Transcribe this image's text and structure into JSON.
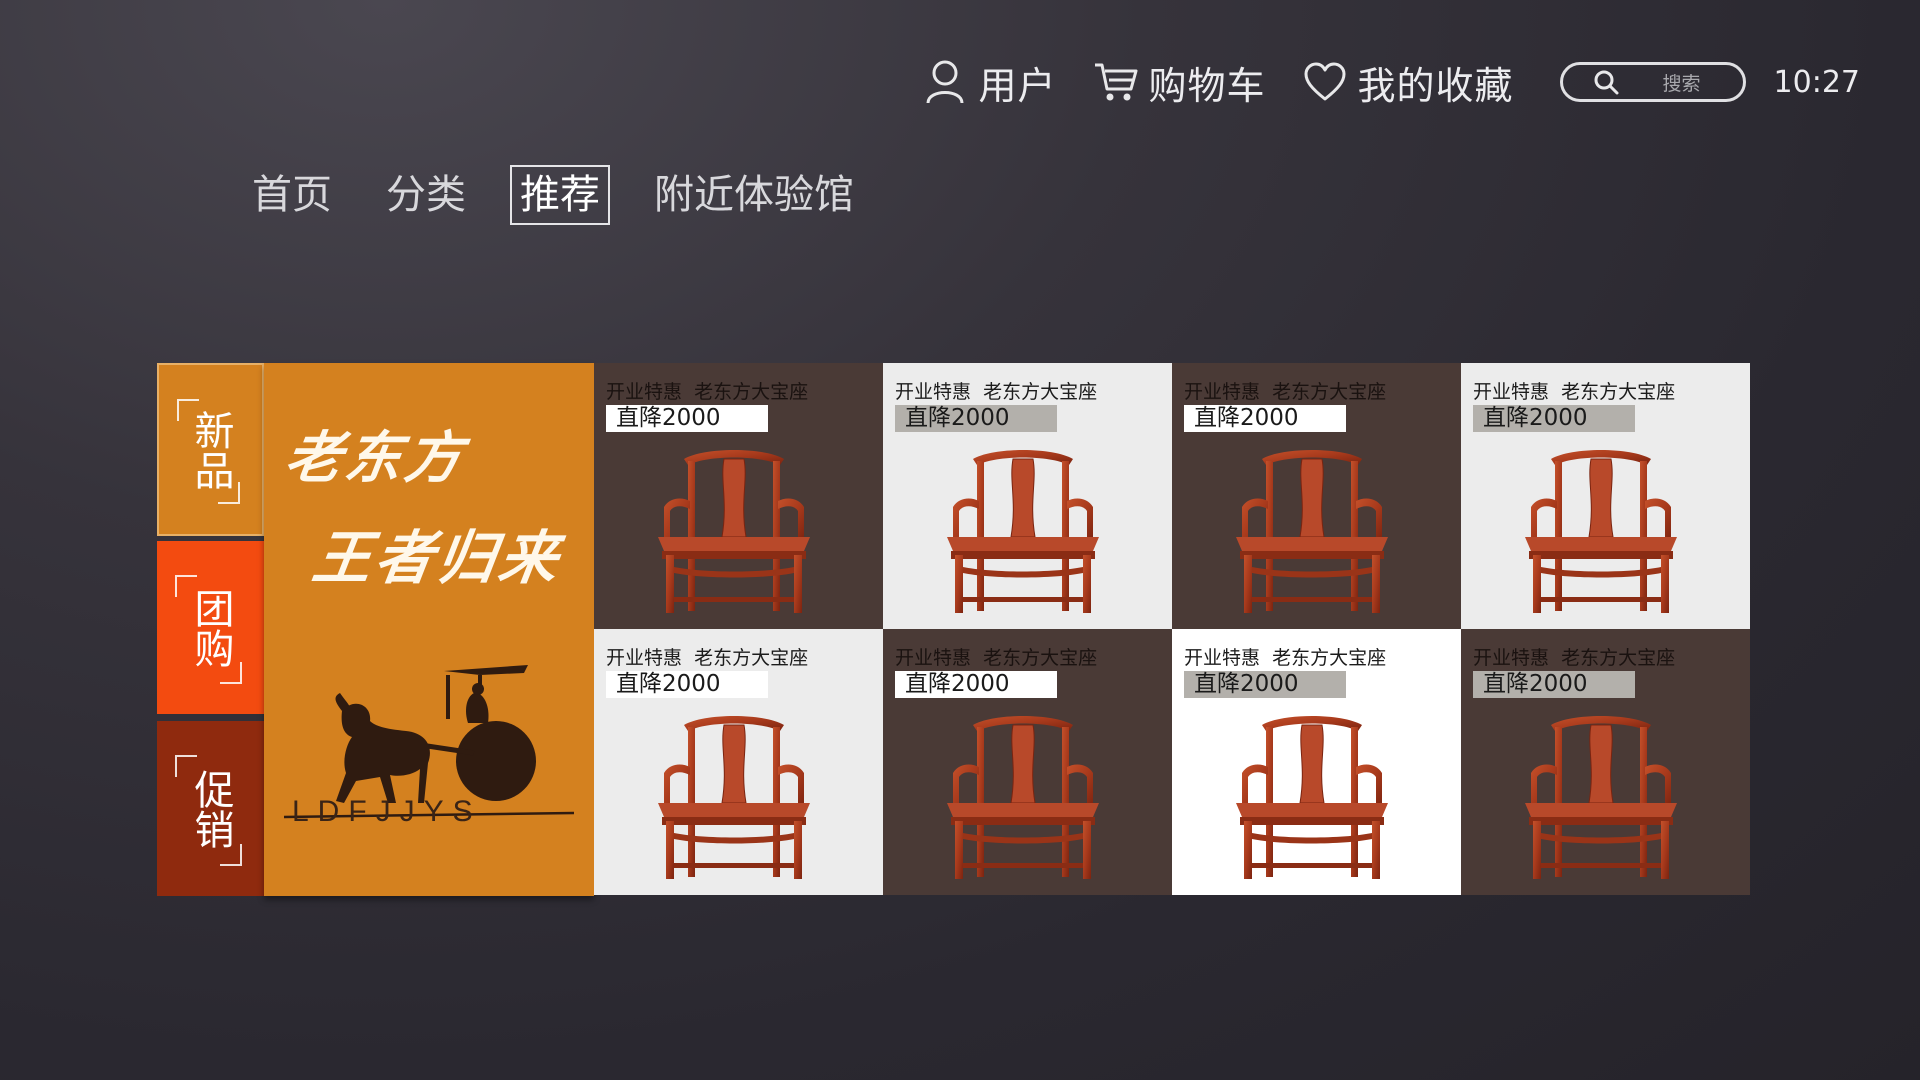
{
  "header": {
    "user_label": "用户",
    "cart_label": "购物车",
    "favorites_label": "我的收藏",
    "search_placeholder": "搜索",
    "clock": "10:27"
  },
  "nav": {
    "tabs": [
      {
        "label": "首页",
        "active": false
      },
      {
        "label": "分类",
        "active": false
      },
      {
        "label": "推荐",
        "active": true
      },
      {
        "label": "附近体验馆",
        "active": false
      }
    ]
  },
  "categories": [
    {
      "label": "新品",
      "color": "#d4811f"
    },
    {
      "label": "团购",
      "color": "#f34b10"
    },
    {
      "label": "促销",
      "color": "#8f2a0e"
    }
  ],
  "banner": {
    "slogan_line1": "老东方",
    "slogan_line2": "王者归来",
    "logo_text": "LDFJJYS",
    "background": "#d4811f"
  },
  "products": [
    {
      "title": "开业特惠  老东方大宝座",
      "price": "直降2000",
      "bg": "dark"
    },
    {
      "title": "开业特惠  老东方大宝座",
      "price": "直降2000",
      "bg": "light"
    },
    {
      "title": "开业特惠  老东方大宝座",
      "price": "直降2000",
      "bg": "dark"
    },
    {
      "title": "开业特惠  老东方大宝座",
      "price": "直降2000",
      "bg": "light"
    },
    {
      "title": "开业特惠  老东方大宝座",
      "price": "直降2000",
      "bg": "light"
    },
    {
      "title": "开业特惠  老东方大宝座",
      "price": "直降2000",
      "bg": "dark"
    },
    {
      "title": "开业特惠  老东方大宝座",
      "price": "直降2000",
      "bg": "white"
    },
    {
      "title": "开业特惠  老东方大宝座",
      "price": "直降2000",
      "bg": "dark"
    }
  ]
}
